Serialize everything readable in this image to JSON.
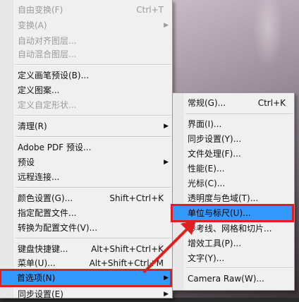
{
  "main_menu": {
    "items": [
      {
        "label": "自由变换(F)",
        "shortcut": "Ctrl+T",
        "disabled": true
      },
      {
        "label": "变换(A)",
        "shortcut": "",
        "disabled": true,
        "submenu": true
      },
      {
        "label": "自动对齐图层...",
        "shortcut": "",
        "disabled": true
      },
      {
        "label": "自动混合图层...",
        "shortcut": "",
        "disabled": true
      },
      {
        "label": "定义画笔预设(B)...",
        "shortcut": ""
      },
      {
        "label": "定义图案...",
        "shortcut": ""
      },
      {
        "label": "定义自定形状...",
        "shortcut": "",
        "disabled": true
      },
      {
        "label": "清理(R)",
        "shortcut": "",
        "submenu": true
      },
      {
        "label": "Adobe PDF 预设...",
        "shortcut": ""
      },
      {
        "label": "预设",
        "shortcut": "",
        "submenu": true
      },
      {
        "label": "远程连接...",
        "shortcut": ""
      },
      {
        "label": "颜色设置(G)...",
        "shortcut": "Shift+Ctrl+K"
      },
      {
        "label": "指定配置文件...",
        "shortcut": ""
      },
      {
        "label": "转换为配置文件(V)...",
        "shortcut": ""
      },
      {
        "label": "键盘快捷键...",
        "shortcut": "Alt+Shift+Ctrl+K"
      },
      {
        "label": "菜单(U)...",
        "shortcut": "Alt+Shift+Ctrl+M"
      },
      {
        "label": "首选项(N)",
        "shortcut": "",
        "submenu": true,
        "highlighted": true
      },
      {
        "label": "同步设置(E)",
        "shortcut": "",
        "submenu": true
      }
    ]
  },
  "sub_menu": {
    "items": [
      {
        "label": "常规(G)...",
        "shortcut": "Ctrl+K"
      },
      {
        "label": "界面(I)...",
        "shortcut": ""
      },
      {
        "label": "同步设置(Y)...",
        "shortcut": ""
      },
      {
        "label": "文件处理(F)...",
        "shortcut": ""
      },
      {
        "label": "性能(E)...",
        "shortcut": ""
      },
      {
        "label": "光标(C)...",
        "shortcut": ""
      },
      {
        "label": "透明度与色域(T)...",
        "shortcut": ""
      },
      {
        "label": "单位与标尺(U)...",
        "shortcut": "",
        "highlighted": true
      },
      {
        "label": "参考线、网格和切片...",
        "shortcut": ""
      },
      {
        "label": "增效工具(P)...",
        "shortcut": ""
      },
      {
        "label": "文字(Y)...",
        "shortcut": ""
      },
      {
        "label": "Camera Raw(W)...",
        "shortcut": ""
      }
    ]
  },
  "colors": {
    "highlight": "#3399ff",
    "annotation_red": "#e02020",
    "menu_bg": "#f0f0f0",
    "disabled_text": "#9a9a9a"
  }
}
